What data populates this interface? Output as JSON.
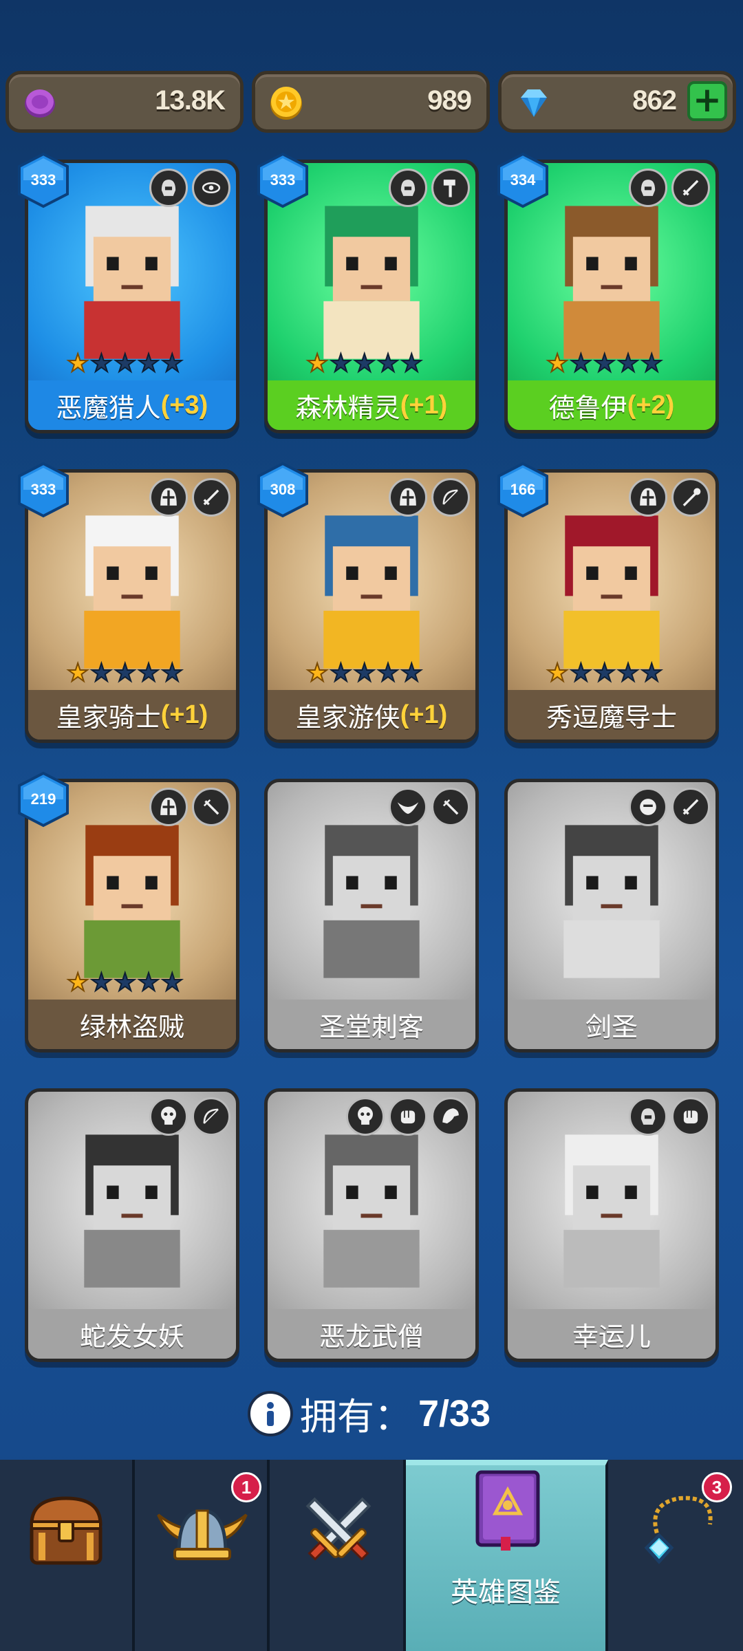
{
  "currencies": [
    {
      "icon": "purple-orb-icon",
      "value": "13.8K",
      "color": "#a34cc4"
    },
    {
      "icon": "gold-coin-icon",
      "value": "989",
      "color": "#f3b71b"
    },
    {
      "icon": "blue-gem-icon",
      "value": "862",
      "color": "#36a9ee",
      "has_add": true
    }
  ],
  "heroes": [
    {
      "name": "恶魔猎人",
      "bonus": "(+3)",
      "level": "333",
      "stars": 1,
      "theme": "blue",
      "owned": true
    },
    {
      "name": "森林精灵",
      "bonus": "(+1)",
      "level": "333",
      "stars": 1,
      "theme": "green",
      "owned": true
    },
    {
      "name": "德鲁伊",
      "bonus": "(+2)",
      "level": "334",
      "stars": 1,
      "theme": "green",
      "owned": true
    },
    {
      "name": "皇家骑士",
      "bonus": "(+1)",
      "level": "333",
      "stars": 1,
      "theme": "brown",
      "owned": true
    },
    {
      "name": "皇家游侠",
      "bonus": "(+1)",
      "level": "308",
      "stars": 1,
      "theme": "brown",
      "owned": true
    },
    {
      "name": "秀逗魔导士",
      "bonus": "",
      "level": "166",
      "stars": 1,
      "theme": "brown",
      "owned": true
    },
    {
      "name": "绿林盗贼",
      "bonus": "",
      "level": "219",
      "stars": 1,
      "theme": "brown",
      "owned": true
    },
    {
      "name": "圣堂刺客",
      "bonus": "",
      "level": "",
      "stars": 0,
      "theme": "gray",
      "owned": false
    },
    {
      "name": "剑圣",
      "bonus": "",
      "level": "",
      "stars": 0,
      "theme": "gray",
      "owned": false
    },
    {
      "name": "蛇发女妖",
      "bonus": "",
      "level": "",
      "stars": 0,
      "theme": "gray",
      "owned": false
    },
    {
      "name": "恶龙武僧",
      "bonus": "",
      "level": "",
      "stars": 0,
      "theme": "gray",
      "owned": false
    },
    {
      "name": "幸运儿",
      "bonus": "",
      "level": "",
      "stars": 0,
      "theme": "gray",
      "owned": false
    }
  ],
  "owned": {
    "label": "拥有：",
    "count": "7/33"
  },
  "nav": {
    "tabs": [
      {
        "name": "chest",
        "icon": "treasure-chest-icon",
        "label": "",
        "badge": ""
      },
      {
        "name": "heroes",
        "icon": "viking-helmet-icon",
        "label": "",
        "badge": "1"
      },
      {
        "name": "battle",
        "icon": "crossed-swords-icon",
        "label": "",
        "badge": ""
      },
      {
        "name": "hero-codex",
        "icon": "spellbook-icon",
        "label": "英雄图鉴",
        "badge": "",
        "active": true
      },
      {
        "name": "accessories",
        "icon": "amulet-icon",
        "label": "",
        "badge": "3"
      }
    ]
  },
  "colors": {
    "active_tab": "#6bbdc3",
    "notification": "#d61f4a",
    "bonus_text": "#ffd23a"
  }
}
